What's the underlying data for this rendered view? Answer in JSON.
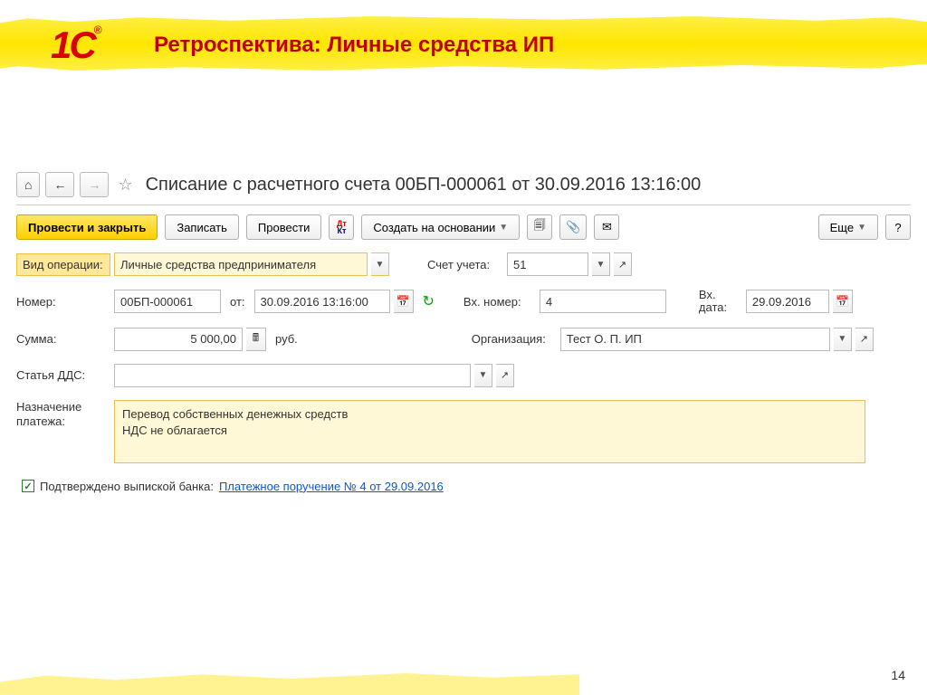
{
  "banner": {
    "logo": "1С",
    "title": "Ретроспектива: Личные средства ИП"
  },
  "nav": {
    "doc_title": "Списание с расчетного счета 00БП-000061 от 30.09.2016 13:16:00"
  },
  "toolbar": {
    "post_close": "Провести и закрыть",
    "save": "Записать",
    "post": "Провести",
    "create_based": "Создать на основании",
    "more": "Еще"
  },
  "fields": {
    "op_label": "Вид операции:",
    "op_value": "Личные средства предпринимателя",
    "account_label": "Счет учета:",
    "account_value": "51",
    "number_label": "Номер:",
    "number_value": "00БП-000061",
    "from_label": "от:",
    "date_value": "30.09.2016 13:16:00",
    "in_number_label": "Вх. номер:",
    "in_number_value": "4",
    "in_date_label": "Вх. дата:",
    "in_date_value": "29.09.2016",
    "sum_label": "Сумма:",
    "sum_value": "5 000,00",
    "currency": "руб.",
    "org_label": "Организация:",
    "org_value": "Тест О. П. ИП",
    "dds_label": "Статья ДДС:",
    "dds_value": "",
    "purpose_label": "Назначение платежа:",
    "purpose_value": "Перевод собственных денежных средств\nНДС не облагается",
    "confirmed_label": "Подтверждено выпиской банка:",
    "bank_link": "Платежное поручение № 4 от 29.09.2016"
  },
  "page_num": "14"
}
